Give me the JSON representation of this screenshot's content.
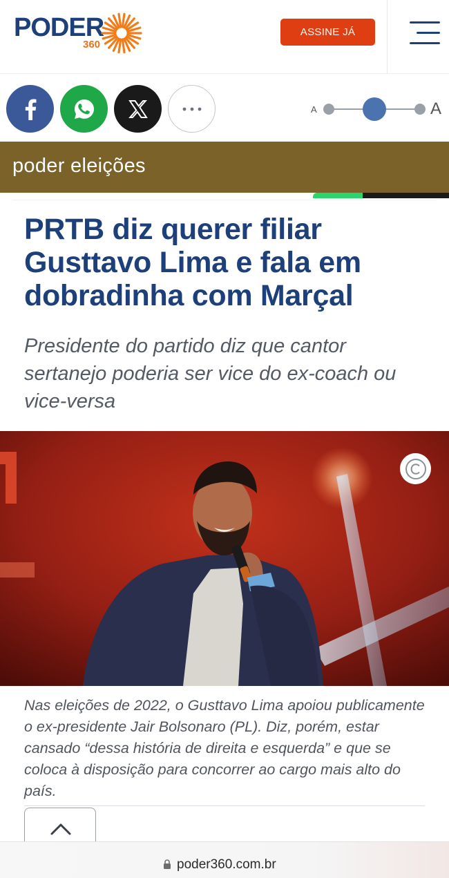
{
  "header": {
    "logo_word": "PODER",
    "logo_number": "360",
    "subscribe_label": "ASSINE JÁ",
    "menu_icon": "hamburger-menu-icon",
    "brand_color": "#1d3f7a",
    "accent_color": "#de3e12"
  },
  "share": {
    "buttons": [
      {
        "name": "facebook",
        "icon": "facebook-icon",
        "color": "#3b5998"
      },
      {
        "name": "whatsapp",
        "icon": "whatsapp-icon",
        "color": "#1fa847"
      },
      {
        "name": "x",
        "icon": "x-icon",
        "color": "#1a1a1a"
      },
      {
        "name": "more",
        "icon": "ellipsis-icon",
        "color": "#ffffff"
      }
    ]
  },
  "font_size_control": {
    "small_label": "A",
    "large_label": "A",
    "level": "medium",
    "level_index": 2,
    "level_count": 3
  },
  "section": {
    "label": "poder eleições",
    "color": "#7a6229"
  },
  "article": {
    "headline": "PRTB diz querer filiar Gusttavo Lima e fala em dobradinha com Marçal",
    "subtitle": "Presidente do partido diz que cantor sertanejo poderia ser vice do ex-coach ou vice-versa",
    "photo": {
      "copyright_icon": "copyright-icon"
    },
    "caption": "Nas eleições de 2022, o Gusttavo Lima apoiou publicamente o ex-presidente Jair Bolsonaro (PL). Diz, porém, estar cansado “dessa história de direita e esquerda” e que se coloca à disposição para concorrer ao cargo mais alto do país."
  },
  "scroll_top": {
    "icon": "chevron-up-icon"
  },
  "browser": {
    "url": "poder360.com.br",
    "lock_icon": "lock-icon"
  }
}
